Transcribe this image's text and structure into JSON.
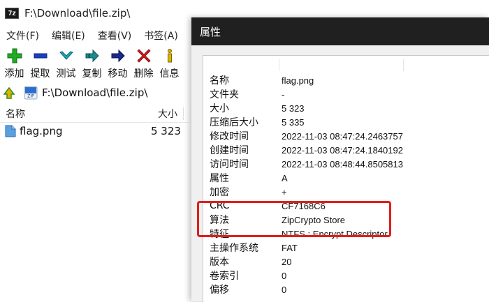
{
  "window": {
    "app_icon_text": "7z",
    "title": "F:\\Download\\file.zip\\"
  },
  "menu": [
    "文件(F)",
    "编辑(E)",
    "查看(V)",
    "书签(A)"
  ],
  "toolbar": [
    {
      "label": "添加",
      "icon": "add-icon",
      "color": "#22aa22"
    },
    {
      "label": "提取",
      "icon": "extract-icon",
      "color": "#1a3fbf"
    },
    {
      "label": "测试",
      "icon": "test-icon",
      "color": "#1aa3b8"
    },
    {
      "label": "复制",
      "icon": "copy-icon",
      "color": "#1a8a8a"
    },
    {
      "label": "移动",
      "icon": "move-icon",
      "color": "#1a2a8a"
    },
    {
      "label": "删除",
      "icon": "delete-icon",
      "color": "#d01818"
    },
    {
      "label": "信息",
      "icon": "info-icon",
      "color": "#d9b400"
    }
  ],
  "address": "F:\\Download\\file.zip\\",
  "file_list": {
    "columns": [
      "名称",
      "大小"
    ],
    "rows": [
      {
        "name": "flag.png",
        "size": "5 323"
      }
    ]
  },
  "dialog": {
    "title": "属性",
    "properties": [
      {
        "key": "名称",
        "value": "flag.png"
      },
      {
        "key": "文件夹",
        "value": "-"
      },
      {
        "key": "大小",
        "value": "5 323"
      },
      {
        "key": "压缩后大小",
        "value": "5 335"
      },
      {
        "key": "修改时间",
        "value": "2022-11-03 08:47:24.2463757"
      },
      {
        "key": "创建时间",
        "value": "2022-11-03 08:47:24.1840192"
      },
      {
        "key": "访问时间",
        "value": "2022-11-03 08:48:44.8505813"
      },
      {
        "key": "属性",
        "value": "A"
      },
      {
        "key": "加密",
        "value": "+"
      },
      {
        "key": "CRC",
        "value": "CF7168C6"
      },
      {
        "key": "算法",
        "value": "ZipCrypto Store"
      },
      {
        "key": "特征",
        "value": "NTFS : Encrypt Descriptor"
      },
      {
        "key": "主操作系统",
        "value": "FAT"
      },
      {
        "key": "版本",
        "value": "20"
      },
      {
        "key": "卷索引",
        "value": "0"
      },
      {
        "key": "偏移",
        "value": "0"
      }
    ]
  },
  "colors": {
    "dialog_titlebar": "#202020",
    "highlight": "#e01e1e"
  }
}
